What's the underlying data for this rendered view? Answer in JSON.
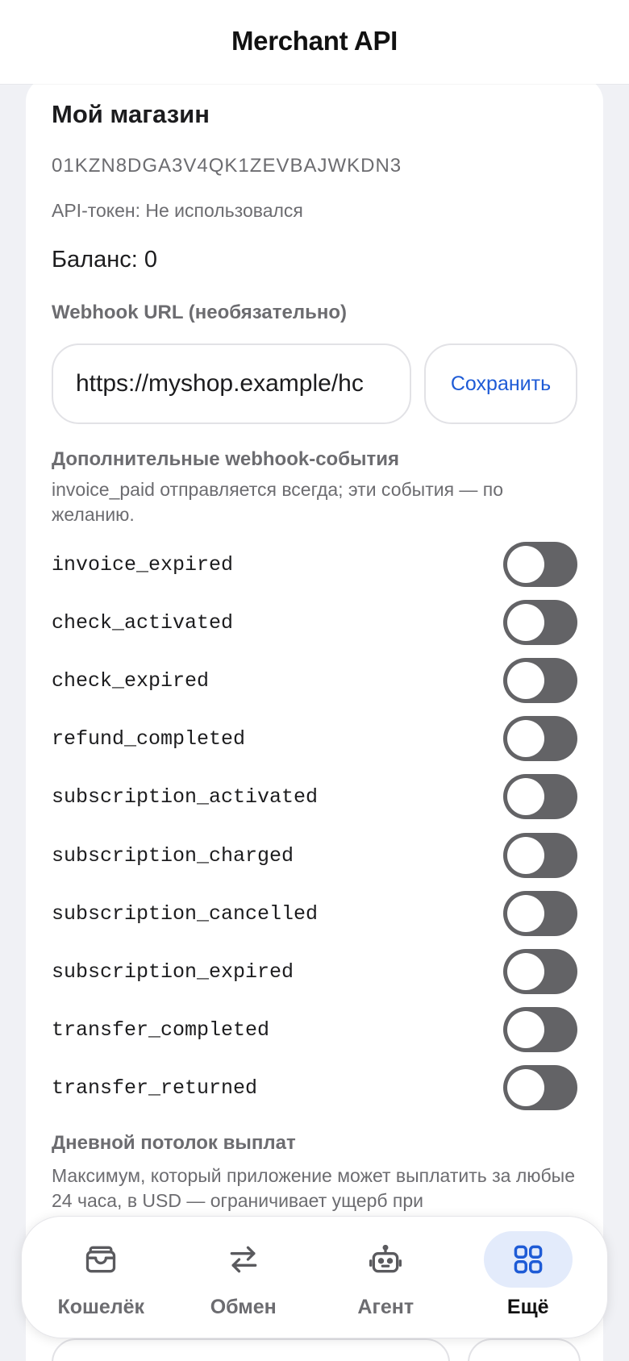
{
  "header": {
    "title": "Merchant API"
  },
  "shop": {
    "name": "Мой магазин",
    "id": "01KZN8DGA3V4QK1ZEVBAJWKDN3",
    "api_token": "API-токен: Не использовался",
    "balance": "Баланс: 0"
  },
  "webhook": {
    "label": "Webhook URL (необязательно)",
    "value": "https://myshop.example/hc",
    "save_label": "Сохранить"
  },
  "events": {
    "title": "Дополнительные webhook-события",
    "description": "invoice_paid отправляется всегда; эти события — по желанию.",
    "items": [
      {
        "label": "invoice_expired",
        "enabled": false
      },
      {
        "label": "check_activated",
        "enabled": false
      },
      {
        "label": "check_expired",
        "enabled": false
      },
      {
        "label": "refund_completed",
        "enabled": false
      },
      {
        "label": "subscription_activated",
        "enabled": false
      },
      {
        "label": "subscription_charged",
        "enabled": false
      },
      {
        "label": "subscription_cancelled",
        "enabled": false
      },
      {
        "label": "subscription_expired",
        "enabled": false
      },
      {
        "label": "transfer_completed",
        "enabled": false
      },
      {
        "label": "transfer_returned",
        "enabled": false
      }
    ]
  },
  "payout_limit": {
    "title": "Дневной потолок выплат",
    "description": "Максимум, который приложение может выплатить за любые 24 часа, в USD — ограничивает ущерб при"
  },
  "tabbar": {
    "active": "more",
    "items": [
      {
        "id": "wallet",
        "label": "Кошелёк",
        "icon": "wallet-icon"
      },
      {
        "id": "exchange",
        "label": "Обмен",
        "icon": "swap-arrows-icon"
      },
      {
        "id": "agent",
        "label": "Агент",
        "icon": "robot-icon"
      },
      {
        "id": "more",
        "label": "Ещё",
        "icon": "grid-icon"
      }
    ]
  },
  "colors": {
    "accent": "#1e5bd6",
    "toggle_off": "#636366",
    "muted_text": "#6c6c70",
    "background": "#f0f1f5"
  }
}
